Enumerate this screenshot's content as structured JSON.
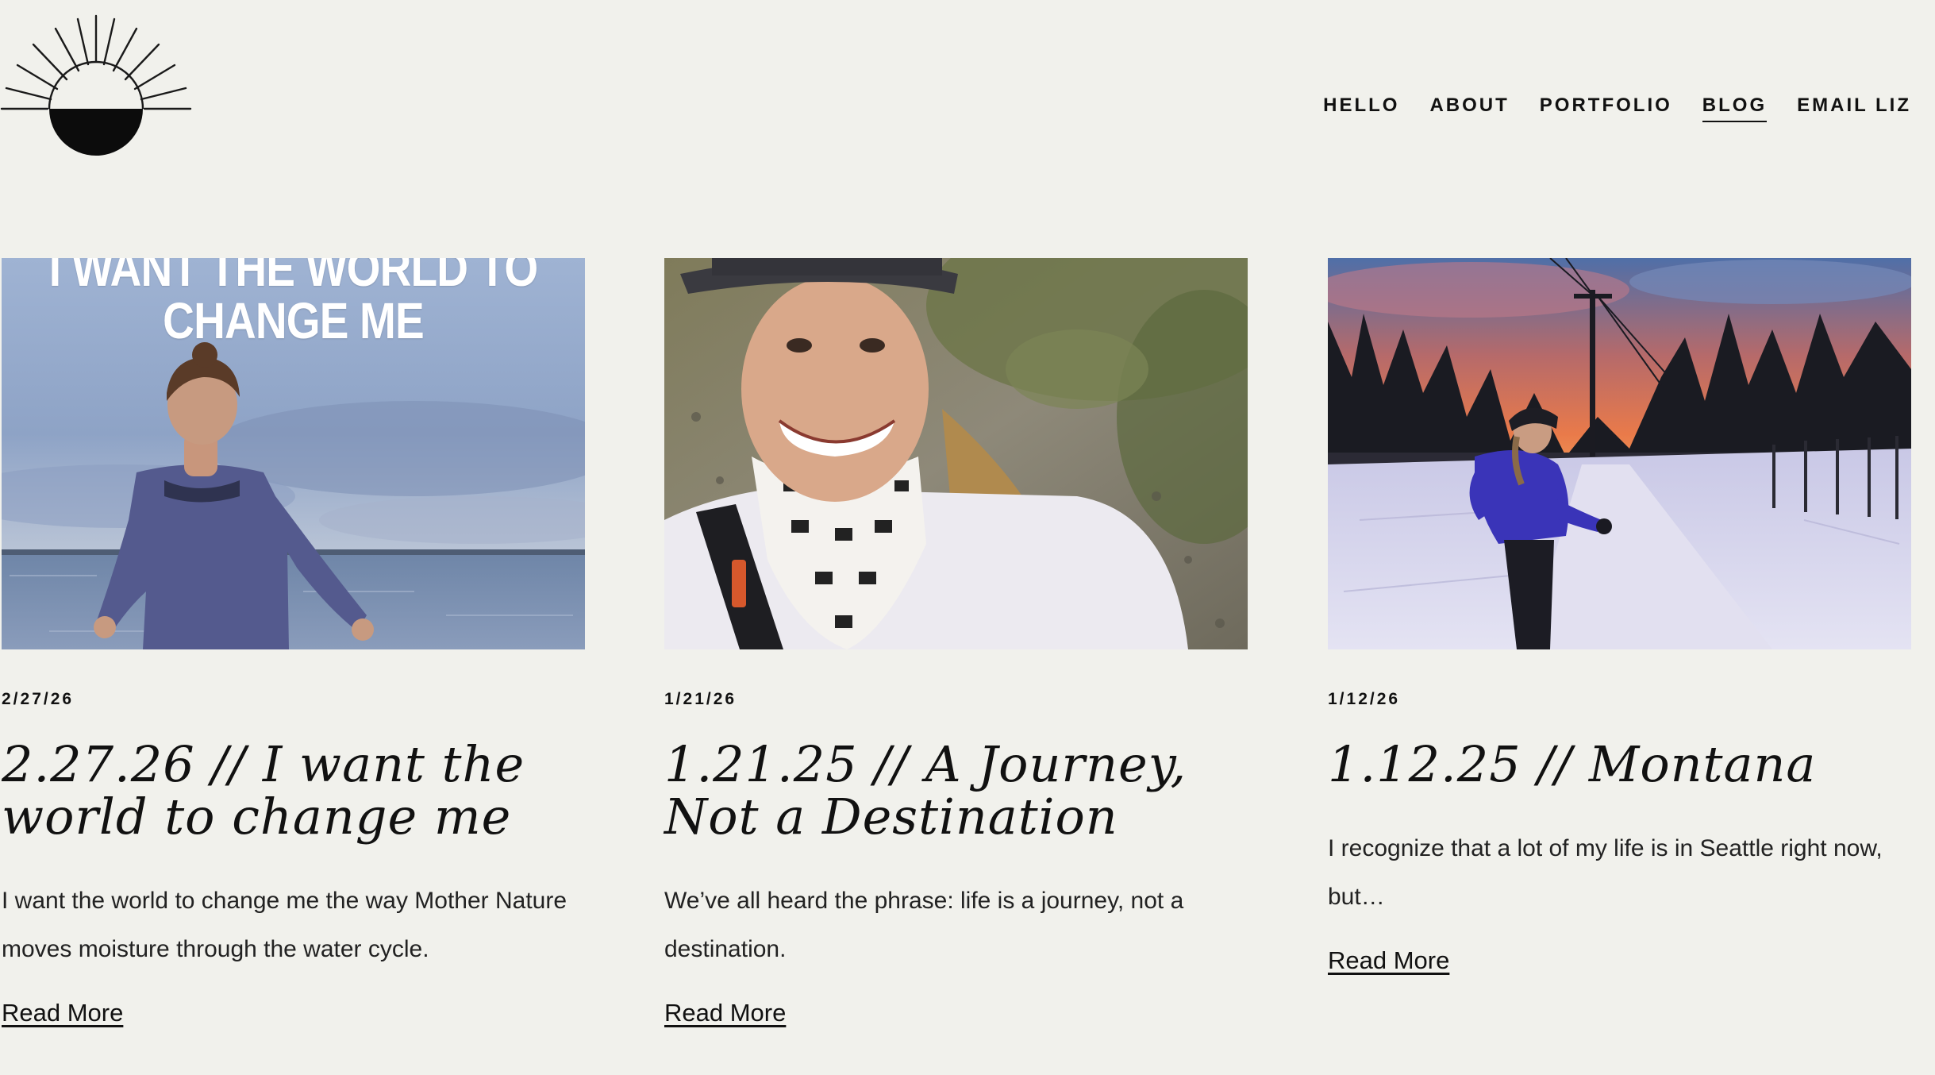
{
  "nav": {
    "items": [
      {
        "label": "HELLO"
      },
      {
        "label": "ABOUT"
      },
      {
        "label": "PORTFOLIO"
      },
      {
        "label": "BLOG",
        "active": true
      },
      {
        "label": "EMAIL LIZ"
      }
    ]
  },
  "posts": [
    {
      "date": "2/27/26",
      "title": "2.27.26 // I want the world to change me",
      "image_text": "I WANT THE WORLD TO CHANGE ME",
      "excerpt": "I want the world to change me the way Mother Nature moves moisture through the water cycle.",
      "read_more": "Read More"
    },
    {
      "date": "1/21/26",
      "title": "1.21.25 // A Journey, Not a Destination",
      "excerpt": "We’ve all heard the phrase: life is a journey, not a destination.",
      "read_more": "Read More"
    },
    {
      "date": "1/12/26",
      "title": "1.12.25 // Montana",
      "excerpt": "I recognize that a lot of my life is in Seattle right now, but…",
      "read_more": "Read More"
    }
  ],
  "colors": {
    "background": "#f1f1ec",
    "text": "#111111"
  }
}
